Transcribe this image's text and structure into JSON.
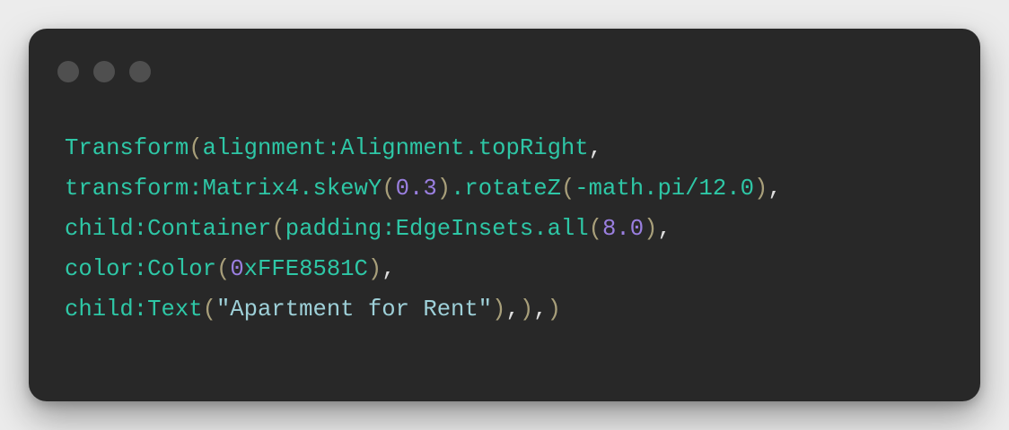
{
  "window": {
    "controls": [
      {
        "name": "close-icon"
      },
      {
        "name": "minimize-icon"
      },
      {
        "name": "maximize-icon"
      }
    ]
  },
  "colors": {
    "background": "#ececec",
    "window": "#282828",
    "dot": "#4f4f4f",
    "identifier": "#2ec7a6",
    "paren": "#a89f7a",
    "punct": "#dddddd",
    "number": "#9a7fe0",
    "string": "#9ed0d8"
  },
  "code": {
    "lines": [
      [
        {
          "t": "Transform",
          "k": "identifier"
        },
        {
          "t": "(",
          "k": "paren"
        },
        {
          "t": "alignment:Alignment.topRight",
          "k": "identifier"
        },
        {
          "t": ",",
          "k": "punct"
        }
      ],
      [
        {
          "t": "transform:Matrix4.skewY",
          "k": "identifier"
        },
        {
          "t": "(",
          "k": "paren"
        },
        {
          "t": "0.3",
          "k": "number"
        },
        {
          "t": ")",
          "k": "paren"
        },
        {
          "t": ".rotateZ",
          "k": "identifier"
        },
        {
          "t": "(",
          "k": "paren"
        },
        {
          "t": "-math.pi/12.0",
          "k": "identifier"
        },
        {
          "t": ")",
          "k": "paren"
        },
        {
          "t": ",",
          "k": "punct"
        }
      ],
      [
        {
          "t": "child:Container",
          "k": "identifier"
        },
        {
          "t": "(",
          "k": "paren"
        },
        {
          "t": "padding:EdgeInsets.all",
          "k": "identifier"
        },
        {
          "t": "(",
          "k": "paren"
        },
        {
          "t": "8.0",
          "k": "number"
        },
        {
          "t": ")",
          "k": "paren"
        },
        {
          "t": ",",
          "k": "punct"
        }
      ],
      [
        {
          "t": "color:Color",
          "k": "identifier"
        },
        {
          "t": "(",
          "k": "paren"
        },
        {
          "t": "0",
          "k": "number"
        },
        {
          "t": "xFFE8581C",
          "k": "identifier"
        },
        {
          "t": ")",
          "k": "paren"
        },
        {
          "t": ",",
          "k": "punct"
        }
      ],
      [
        {
          "t": "child:Text",
          "k": "identifier"
        },
        {
          "t": "(",
          "k": "paren"
        },
        {
          "t": "\"Apartment for Rent\"",
          "k": "string"
        },
        {
          "t": ")",
          "k": "paren"
        },
        {
          "t": ",",
          "k": "punct"
        },
        {
          "t": ")",
          "k": "paren"
        },
        {
          "t": ",",
          "k": "punct"
        },
        {
          "t": ")",
          "k": "paren"
        }
      ]
    ]
  }
}
